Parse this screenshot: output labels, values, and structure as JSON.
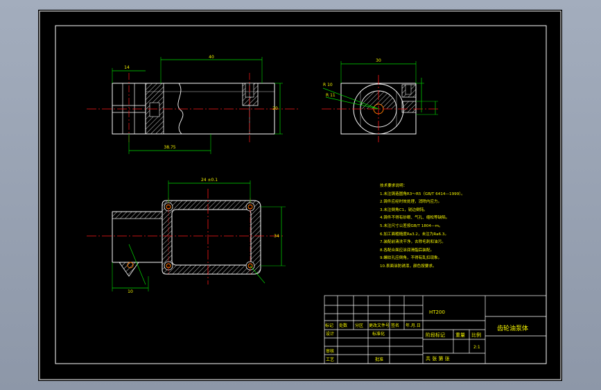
{
  "drawing": {
    "colors": {
      "background": "#000000",
      "frame": "#ffffff",
      "outline": "#ffffff",
      "dimension": "#00e000",
      "centerline": "#ff1a1a",
      "hatch": "#ffffff",
      "text": "#f7f700",
      "hole": "#ff7a00"
    },
    "dimensions": {
      "front_top_width": "40",
      "front_left_width": "14",
      "front_right_height": "20",
      "front_bottom": "38.75",
      "side_top": "30",
      "side_radius_a": "R 10",
      "side_radius_b": "R 11",
      "plan_top": "24 ±0.1",
      "plan_right": "34",
      "plan_bottom": "10"
    },
    "tech_notes": {
      "title": "技术要求说明：",
      "items": [
        "1.未注铸造圆角R3～R5（GB/T 6414—1999）。",
        "2.铸件应经时效处理，消除内应力。",
        "3.未注倒角C1，锐边倒钝。",
        "4.铸件不得有砂眼、气孔、缩松等缺陷。",
        "5.未注尺寸公差按GB/T 1804—m。",
        "6.加工面粗糙度Ra3.2，未注为Ra6.3。",
        "7.装配前清洗干净，去除毛刺和油污。",
        "8.各配合面应涂润滑脂后装配。",
        "9.螺纹孔应倒角，不得有乱扣现象。",
        "10.表面涂防锈漆，颜色按要求。"
      ]
    },
    "title_block": {
      "material": "HT200",
      "name": "齿轮油泵体",
      "row_labels": [
        "标记",
        "处数",
        "分区",
        "更改文件号",
        "签名",
        "年.月.日"
      ],
      "design": "设计",
      "standardization": "标准化",
      "review": "审核",
      "process": "工艺",
      "approve": "批准",
      "stage": "阶段标记",
      "weight": "重量",
      "scale": "比例",
      "scale_value": "2:1",
      "sheet": "共  张  第  张"
    }
  }
}
